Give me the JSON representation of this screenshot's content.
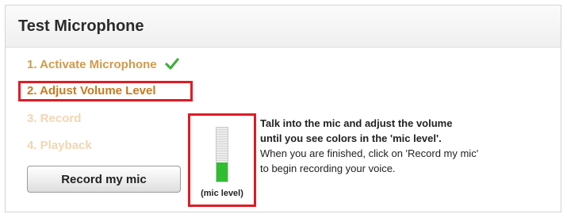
{
  "title": "Test Microphone",
  "steps": [
    {
      "label": "1. Activate Microphone",
      "state": "done"
    },
    {
      "label": "2. Adjust Volume Level",
      "state": "active"
    },
    {
      "label": "3. Record",
      "state": "disabled"
    },
    {
      "label": "4. Playback",
      "state": "disabled"
    }
  ],
  "record_button": {
    "label": "Record my mic"
  },
  "mic_meter": {
    "label": "(mic level)",
    "level": 0.35,
    "fill_color": "#2fbe2f"
  },
  "instructions": {
    "line1": "Talk into the mic and adjust the volume",
    "line2": "until you see colors in the 'mic level'.",
    "line3": "When you are finished, click on 'Record my mic'",
    "line4": "to begin recording your voice."
  },
  "colors": {
    "highlight": "#e01b24",
    "step_active": "#c87a1e",
    "check": "#3fae3f"
  }
}
